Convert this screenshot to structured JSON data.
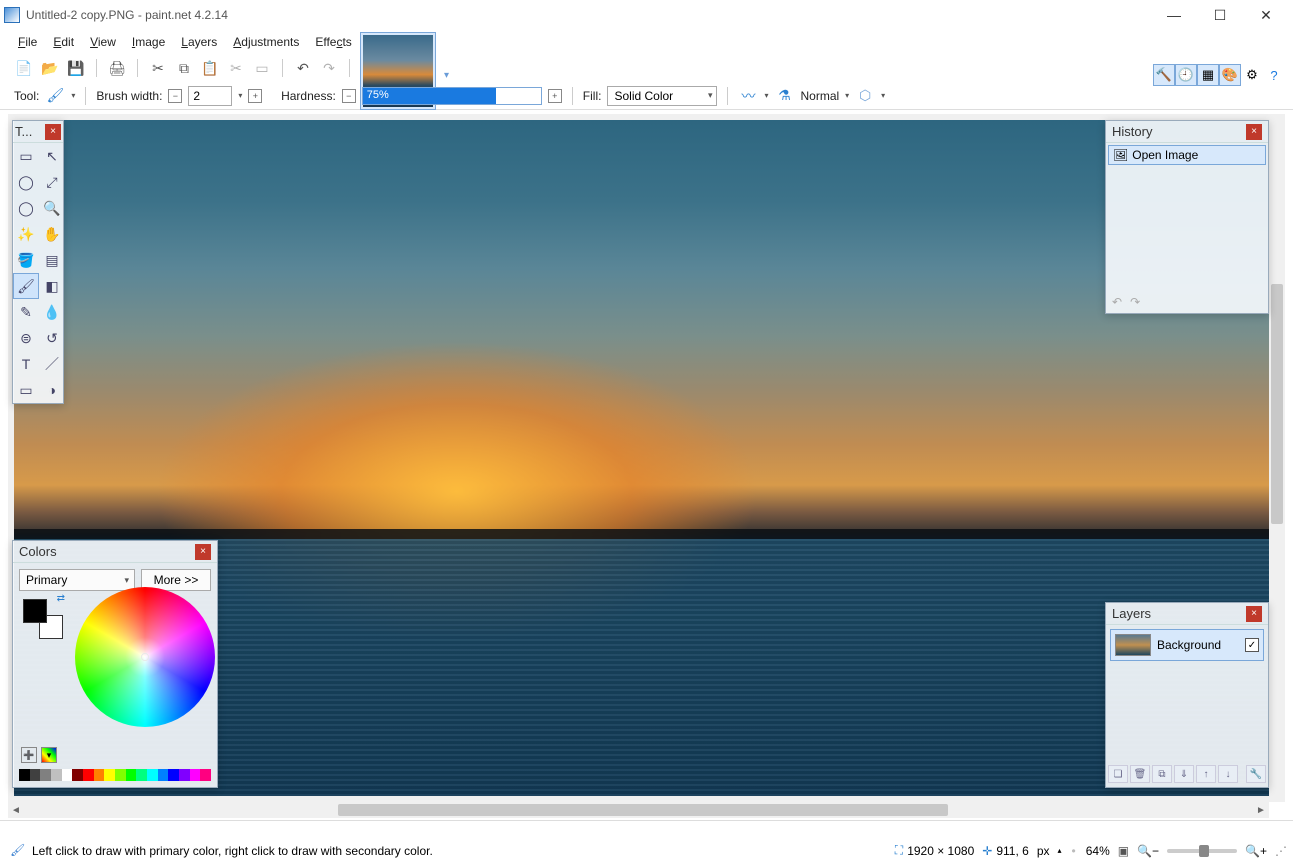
{
  "titlebar": {
    "title": "Untitled-2 copy.PNG - paint.net 4.2.14"
  },
  "menu": [
    "File",
    "Edit",
    "View",
    "Image",
    "Layers",
    "Adjustments",
    "Effects"
  ],
  "toolopts": {
    "tool_label": "Tool:",
    "brush_label": "Brush width:",
    "brush_value": "2",
    "hardness_label": "Hardness:",
    "hardness_value": "75%",
    "fill_label": "Fill:",
    "fill_value": "Solid Color",
    "blend_value": "Normal"
  },
  "panels": {
    "tools_title": "T...",
    "history_title": "History",
    "history_item": "Open Image",
    "layers_title": "Layers",
    "layer_name": "Background",
    "colors_title": "Colors",
    "color_mode": "Primary",
    "more": "More >>"
  },
  "status": {
    "hint": "Left click to draw with primary color, right click to draw with secondary color.",
    "dims": "1920 × 1080",
    "coords": "911, 6",
    "unit": "px",
    "zoom": "64%"
  },
  "palette": [
    "#000",
    "#404040",
    "#808080",
    "#c0c0c0",
    "#fff",
    "#800000",
    "#f00",
    "#ff8000",
    "#ff0",
    "#80ff00",
    "#0f0",
    "#00ff80",
    "#0ff",
    "#0080ff",
    "#00f",
    "#8000ff",
    "#f0f",
    "#ff0080"
  ]
}
